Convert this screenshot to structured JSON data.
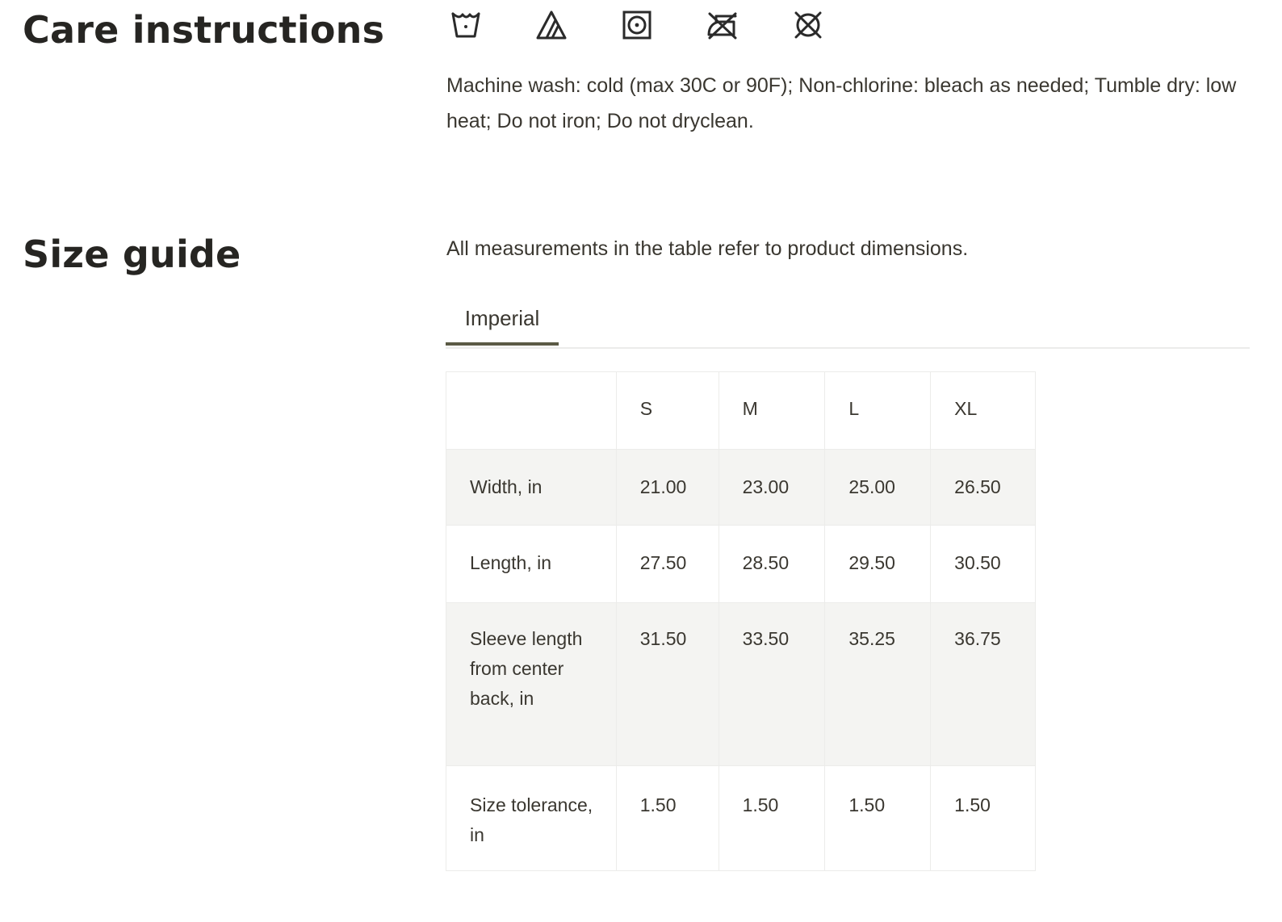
{
  "care": {
    "title": "Care instructions",
    "icons": [
      "machine-wash-cold-icon",
      "non-chlorine-bleach-icon",
      "tumble-dry-low-icon",
      "do-not-iron-icon",
      "do-not-dryclean-icon"
    ],
    "text": "Machine wash: cold (max 30C or 90F); Non-chlorine: bleach as needed; Tumble dry: low heat; Do not iron; Do not dryclean."
  },
  "size_guide": {
    "title": "Size guide",
    "note": "All measurements in the table refer to product dimensions.",
    "tabs": [
      {
        "label": "Imperial",
        "active": true
      }
    ],
    "table": {
      "columns": [
        "",
        "S",
        "M",
        "L",
        "XL"
      ],
      "rows": [
        {
          "label": "Width, in",
          "values": [
            "21.00",
            "23.00",
            "25.00",
            "26.50"
          ]
        },
        {
          "label": "Length, in",
          "values": [
            "27.50",
            "28.50",
            "29.50",
            "30.50"
          ]
        },
        {
          "label": "Sleeve length from center back, in",
          "values": [
            "31.50",
            "33.50",
            "35.25",
            "36.75"
          ]
        },
        {
          "label": "Size tolerance, in",
          "values": [
            "1.50",
            "1.50",
            "1.50",
            "1.50"
          ]
        }
      ]
    }
  },
  "colors": {
    "heading": "#262522",
    "text": "#3a3730",
    "tab_underline": "#5b5a45",
    "row_stripe": "#f4f4f2",
    "border": "#ececea"
  }
}
